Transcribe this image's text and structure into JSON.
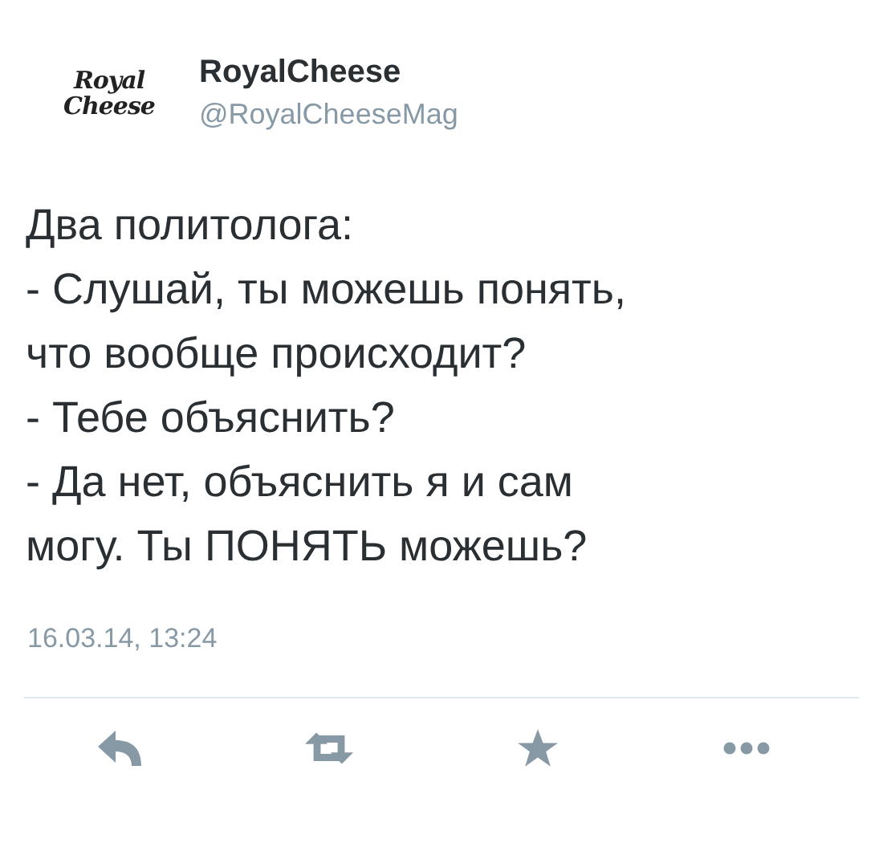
{
  "author": {
    "logo_lines": [
      "Royal",
      "Cheese"
    ],
    "name": "RoyalCheese",
    "handle": "@RoyalCheeseMag"
  },
  "tweet": {
    "lines": [
      "Два политолога:",
      "- Слушай, ты можешь понять,",
      "что вообще происходит?",
      "- Тебе объяснить?",
      "- Да нет, объяснить я и сам",
      "могу. Ты ПОНЯТЬ можешь?"
    ],
    "timestamp": "16.03.14, 13:24"
  },
  "actions": [
    {
      "kind": "reply"
    },
    {
      "kind": "retweet"
    },
    {
      "kind": "favorite"
    },
    {
      "kind": "more"
    }
  ]
}
